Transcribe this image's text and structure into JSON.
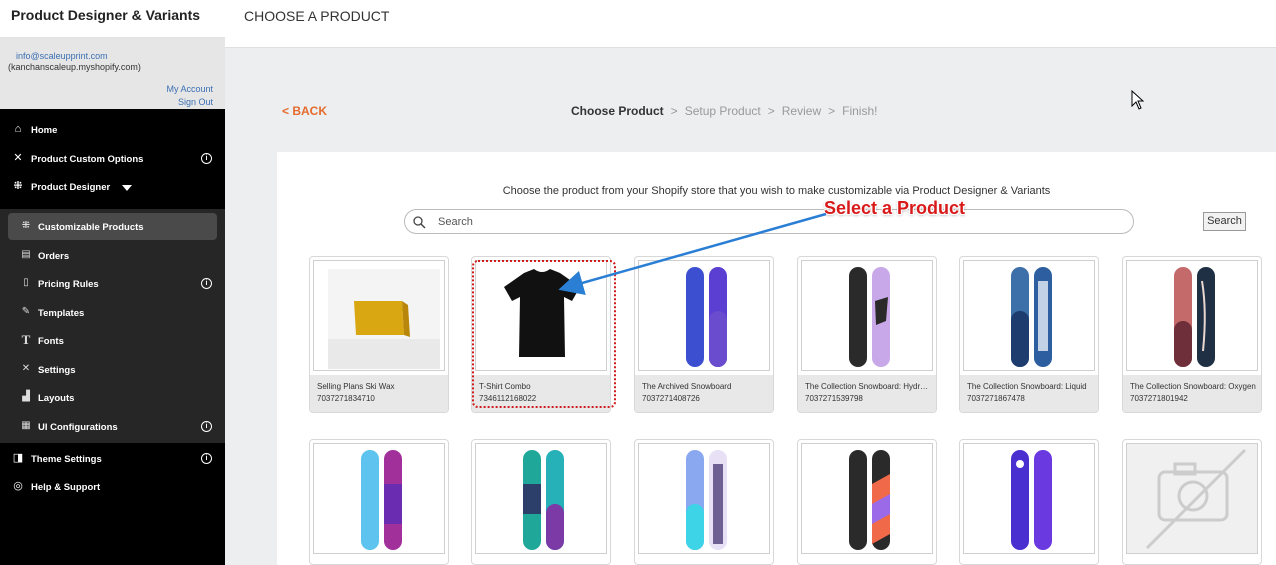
{
  "app": {
    "title": "Product Designer & Variants",
    "email": "info@scaleupprint.com",
    "shop": "(kanchanscaleup.myshopify.com)",
    "my_account": "My Account",
    "sign_out": "Sign Out"
  },
  "nav": {
    "home": "Home",
    "custom_options": "Product Custom Options",
    "product_designer": "Product Designer",
    "theme_settings": "Theme Settings",
    "help_support": "Help & Support",
    "info_glyph": "i"
  },
  "submenu": {
    "customizable_products": "Customizable Products",
    "orders": "Orders",
    "pricing_rules": "Pricing Rules",
    "templates": "Templates",
    "fonts": "Fonts",
    "settings": "Settings",
    "layouts": "Layouts",
    "ui_configurations": "UI Configurations"
  },
  "page": {
    "title": "CHOOSE A PRODUCT",
    "back": "< BACK",
    "steps": [
      "Choose Product",
      "Setup Product",
      "Review",
      "Finish!"
    ],
    "step_separator": ">",
    "instruction": "Choose the product from your Shopify store that you wish to make customizable via Product Designer & Variants",
    "search_placeholder": "Search",
    "search_button": "Search"
  },
  "annotation": {
    "callout": "Select a Product",
    "highlight_color": "#d01c1c",
    "arrow_color": "#2a7fd4"
  },
  "products": [
    {
      "name": "Selling Plans Ski Wax",
      "id": "7037271834710"
    },
    {
      "name": "T-Shirt Combo",
      "id": "7346112168022"
    },
    {
      "name": "The Archived Snowboard",
      "id": "7037271408726"
    },
    {
      "name": "The Collection Snowboard: Hydrogen",
      "id": "7037271539798"
    },
    {
      "name": "The Collection Snowboard: Liquid",
      "id": "7037271867478"
    },
    {
      "name": "The Collection Snowboard: Oxygen",
      "id": "7037271801942"
    }
  ],
  "colors": {
    "sidebar": "#000000",
    "submenu": "#262626",
    "accent": "#e56a2d",
    "link": "#3b6fb3"
  }
}
